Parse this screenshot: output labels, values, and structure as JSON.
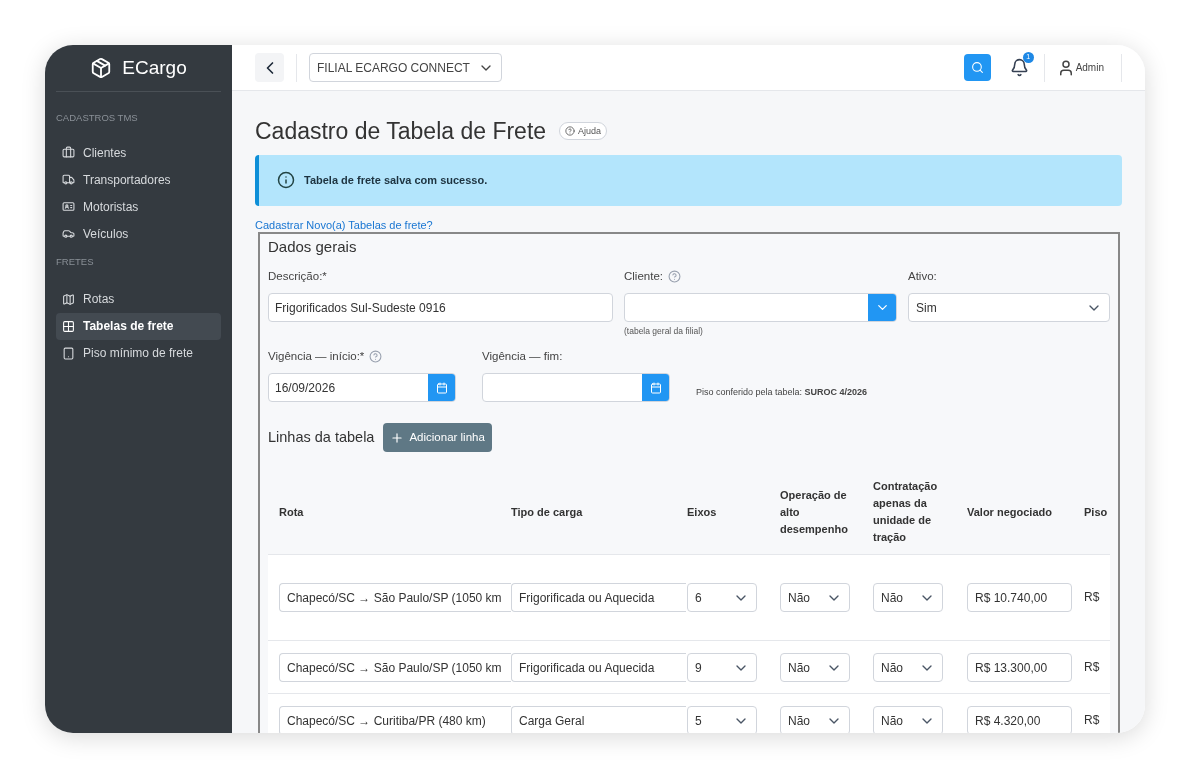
{
  "brand": "ECargo",
  "sidebar": {
    "sections": [
      {
        "title": "CADASTROS TMS",
        "items": [
          {
            "label": "Clientes",
            "kind": "briefcase",
            "selected": false
          },
          {
            "label": "Transportadores",
            "kind": "truck",
            "selected": false
          },
          {
            "label": "Motoristas",
            "kind": "id-card",
            "selected": false
          },
          {
            "label": "Veículos",
            "kind": "car",
            "selected": false
          }
        ]
      },
      {
        "title": "FRETES",
        "items": [
          {
            "label": "Rotas",
            "kind": "map",
            "selected": false
          },
          {
            "label": "Tabelas de frete",
            "kind": "grid",
            "selected": true
          },
          {
            "label": "Piso mínimo de frete",
            "kind": "tablet",
            "selected": false
          }
        ]
      }
    ]
  },
  "topbar": {
    "branch": "FILIAL ECARGO CONNECT",
    "notifications": "1",
    "user": "Admin"
  },
  "page": {
    "title": "Cadastro de Tabela de Frete",
    "help": "Ajuda"
  },
  "alert": {
    "message": "Tabela de frete salva com sucesso."
  },
  "new_link": "Cadastrar Novo(a) Tabelas de frete?",
  "form": {
    "legend": "Dados gerais",
    "descricao": {
      "label": "Descrição:*",
      "value": "Frigorificados Sul-Sudeste 0916"
    },
    "cliente": {
      "label": "Cliente:",
      "help": true,
      "hint": "(tabela geral da filial)"
    },
    "ativo": {
      "label": "Ativo:",
      "value": "Sim"
    },
    "vigencia_inicio": {
      "label": "Vigência — início:*",
      "help": true,
      "value": "16/09/2026"
    },
    "vigencia_fim": {
      "label": "Vigência — fim:"
    },
    "piso_note": "Piso conferido pela tabela: **SUROC 4/2026**"
  },
  "lines": {
    "title": "Linhas da tabela",
    "add_button": "Adicionar linha",
    "columns": [
      "Rota",
      "Tipo de carga",
      "Eixos",
      "Operação de alto desempenho",
      "Contratação apenas da unidade de tração",
      "Valor negociado",
      "Piso"
    ],
    "rows": [
      {
        "rota": "Chapecó/SC → São Paulo/SP (1050 km",
        "tipo": "Frigorificada ou Aquecida",
        "eixos": "6",
        "alto": "Não",
        "tracao": "Não",
        "valor": "R$ 10.740,00",
        "piso": "R$"
      },
      {
        "rota": "Chapecó/SC → São Paulo/SP (1050 km",
        "tipo": "Frigorificada ou Aquecida",
        "eixos": "9",
        "alto": "Não",
        "tracao": "Não",
        "valor": "R$ 13.300,00",
        "piso": "R$"
      },
      {
        "rota": "Chapecó/SC → Curitiba/PR (480 km)",
        "tipo": "Carga Geral",
        "eixos": "5",
        "alto": "Não",
        "tracao": "Não",
        "valor": "R$ 4.320,00",
        "piso": "R$"
      }
    ]
  }
}
